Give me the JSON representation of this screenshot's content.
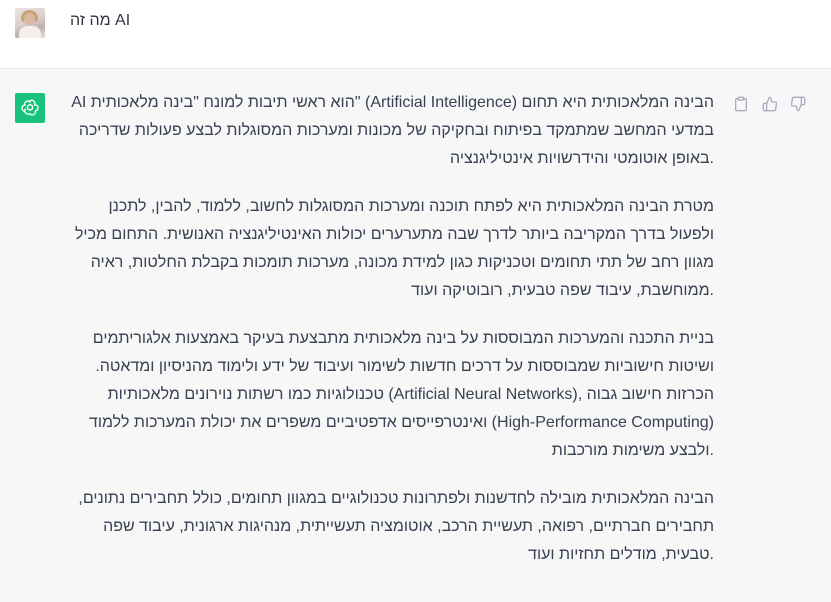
{
  "user": {
    "question": "מה זה AI"
  },
  "assistant": {
    "paragraphs": [
      "הבינה המלאכותית היא תחום (Artificial Intelligence) \"הוא ראשי תיבות למונח \"בינה מלאכותית AI במדעי המחשב שמתמקד בפיתוח ובחקיקה של מכונות ומערכות המסוגלות לבצע פעולות שדריכה .באופן אוטומטי והידרשויות אינטיליגנציה",
      "מטרת הבינה המלאכותית היא לפתח תוכנה ומערכות המסוגלות לחשוב, ללמוד, להבין, לתכנן ולפעול בדרך המקריבה ביותר לדרך שבה מתערערים יכולות האינטיליגנציה האנושית. התחום מכיל מגוון רחב של תתי תחומים וטכניקות כגון למידת מכונה, מערכות תומכות בקבלת החלטות, ראיה .ממוחשבת, עיבוד שפה טבעית, רובוטיקה ועוד",
      "בניית התכנה והמערכות המבוססות על בינה מלאכותית מתבצעת בעיקר באמצעות אלגוריתמים ושיטות חישוביות שמבוססות על דרכים חדשות לשימור ועיבוד של ידע ולימוד מהניסיון ומדאטה. הכרזות חישוב גבוה ,(Artificial Neural Networks) טכנולוגיות כמו רשתות נוירונים מלאכותיות (High-Performance Computing) ואינטרפייסים אדפטיביים משפרים את יכולת המערכות ללמוד .ולבצע משימות מורכבות",
      "הבינה המלאכותית מובילה לחדשנות ולפתרונות טכנולוגיים במגוון תחומים, כולל תחבירים נתונים, תחבירים חברתיים, רפואה, תעשיית הרכב, אוטומציה תעשייתית, מנהיגות ארגונית, עיבוד שפה .טבעית, מודלים תחזיות ועוד"
    ]
  },
  "icons": {
    "user_avatar": "user-avatar-photo",
    "assistant_avatar": "openai-logo-icon",
    "copy": "clipboard-icon",
    "like": "thumbs-up-icon",
    "dislike": "thumbs-down-icon"
  },
  "colors": {
    "assistant_bg": "#f7f7f8",
    "logo_bg": "#19c37d",
    "text": "#374151",
    "icon": "#acacbe"
  }
}
